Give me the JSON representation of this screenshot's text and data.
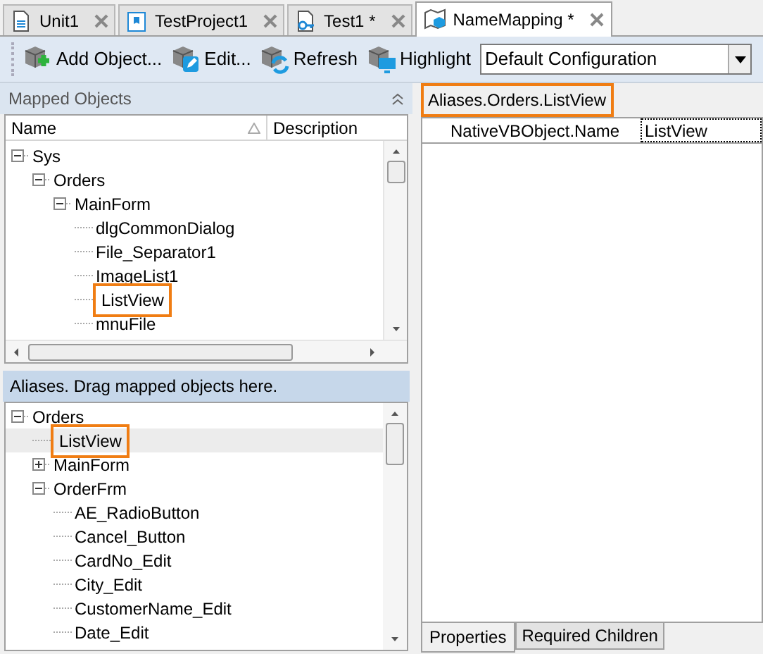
{
  "tabs": [
    {
      "label": "Unit1",
      "selected": false
    },
    {
      "label": "TestProject1",
      "selected": false
    },
    {
      "label": "Test1 *",
      "selected": false
    },
    {
      "label": "NameMapping *",
      "selected": true
    }
  ],
  "toolbar": {
    "buttons": [
      {
        "label": "Add Object..."
      },
      {
        "label": "Edit..."
      },
      {
        "label": "Refresh"
      },
      {
        "label": "Highlight"
      }
    ],
    "configuration": "Default Configuration"
  },
  "mapped_objects": {
    "title": "Mapped Objects",
    "columns": [
      "Name",
      "Description"
    ],
    "tree": [
      {
        "label": "Sys",
        "expanded": true,
        "highlighted": false,
        "children": [
          {
            "label": "Orders",
            "expanded": true,
            "highlighted": false,
            "children": [
              {
                "label": "MainForm",
                "expanded": true,
                "highlighted": false,
                "children": [
                  {
                    "label": "dlgCommonDialog",
                    "highlighted": false
                  },
                  {
                    "label": "File_Separator1",
                    "highlighted": false
                  },
                  {
                    "label": "ImageList1",
                    "highlighted": false
                  },
                  {
                    "label": "ListView",
                    "highlighted": true
                  },
                  {
                    "label": "mnuFile",
                    "highlighted": false
                  }
                ]
              }
            ]
          }
        ]
      }
    ]
  },
  "aliases": {
    "title": "Aliases. Drag mapped objects here.",
    "tree": [
      {
        "label": "Orders",
        "expanded": true,
        "selected": false,
        "highlighted": false,
        "children": [
          {
            "label": "ListView",
            "selected": true,
            "highlighted": true
          },
          {
            "label": "MainForm",
            "expanded": false,
            "selected": false,
            "highlighted": false
          },
          {
            "label": "OrderFrm",
            "expanded": true,
            "selected": false,
            "highlighted": false,
            "children": [
              {
                "label": "AE_RadioButton",
                "selected": false,
                "highlighted": false
              },
              {
                "label": "Cancel_Button",
                "selected": false,
                "highlighted": false
              },
              {
                "label": "CardNo_Edit",
                "selected": false,
                "highlighted": false
              },
              {
                "label": "City_Edit",
                "selected": false,
                "highlighted": false
              },
              {
                "label": "CustomerName_Edit",
                "selected": false,
                "highlighted": false
              },
              {
                "label": "Date_Edit",
                "selected": false,
                "highlighted": false
              }
            ]
          }
        ]
      }
    ]
  },
  "details": {
    "path": "Aliases.Orders.ListView",
    "path_highlighted": true,
    "properties": [
      {
        "name": "NativeVBObject.Name",
        "value": "ListView"
      }
    ],
    "tabs": [
      {
        "label": "Properties",
        "selected": true
      },
      {
        "label": "Required Children",
        "selected": false
      }
    ]
  }
}
